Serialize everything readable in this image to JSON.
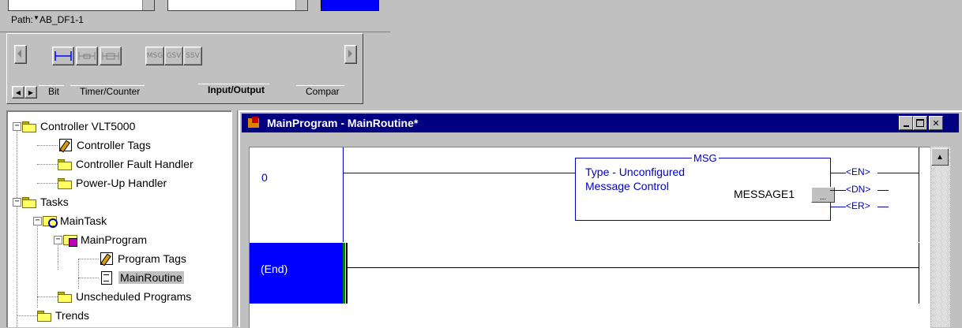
{
  "toolbar": {
    "path_label": "Path:",
    "path_value": "AB_DF1-1"
  },
  "palette": {
    "buttons": [
      {
        "label": "H",
        "active": true
      },
      {
        "label": "",
        "active": false
      },
      {
        "label": "",
        "active": false
      },
      {
        "label": "MSG",
        "active": false
      },
      {
        "label": "GSV",
        "active": false
      },
      {
        "label": "SSV",
        "active": false
      }
    ],
    "tabs": [
      "Bit",
      "Timer/Counter",
      "Input/Output",
      "Compar"
    ],
    "active_tab": "Input/Output"
  },
  "tree": {
    "items": [
      {
        "label": "Controller VLT5000",
        "icon": "folder-icon"
      },
      {
        "label": "Controller Tags",
        "icon": "tags-icon"
      },
      {
        "label": "Controller Fault Handler",
        "icon": "folder-icon"
      },
      {
        "label": "Power-Up Handler",
        "icon": "folder-icon"
      },
      {
        "label": "Tasks",
        "icon": "folder-icon"
      },
      {
        "label": "MainTask",
        "icon": "task-icon"
      },
      {
        "label": "MainProgram",
        "icon": "program-icon"
      },
      {
        "label": "Program Tags",
        "icon": "tags-icon"
      },
      {
        "label": "MainRoutine",
        "icon": "routine-icon",
        "selected": true
      },
      {
        "label": "Unscheduled Programs",
        "icon": "folder-icon"
      },
      {
        "label": "Trends",
        "icon": "folder-icon"
      }
    ]
  },
  "ladder_window": {
    "title": "MainProgram - MainRoutine*",
    "rung0_number": "0",
    "end_label": "(End)",
    "msg": {
      "title": "MSG",
      "line1": "Type - Unconfigured",
      "line2": "Message Control",
      "tag": "MESSAGE1",
      "browse": "..."
    },
    "coils": [
      "EN",
      "DN",
      "ER"
    ]
  },
  "colors": {
    "face": "#c0c0c0",
    "title_bar": "#000080",
    "ladder_blue": "#0000c0",
    "end_highlight": "#0000ff"
  }
}
